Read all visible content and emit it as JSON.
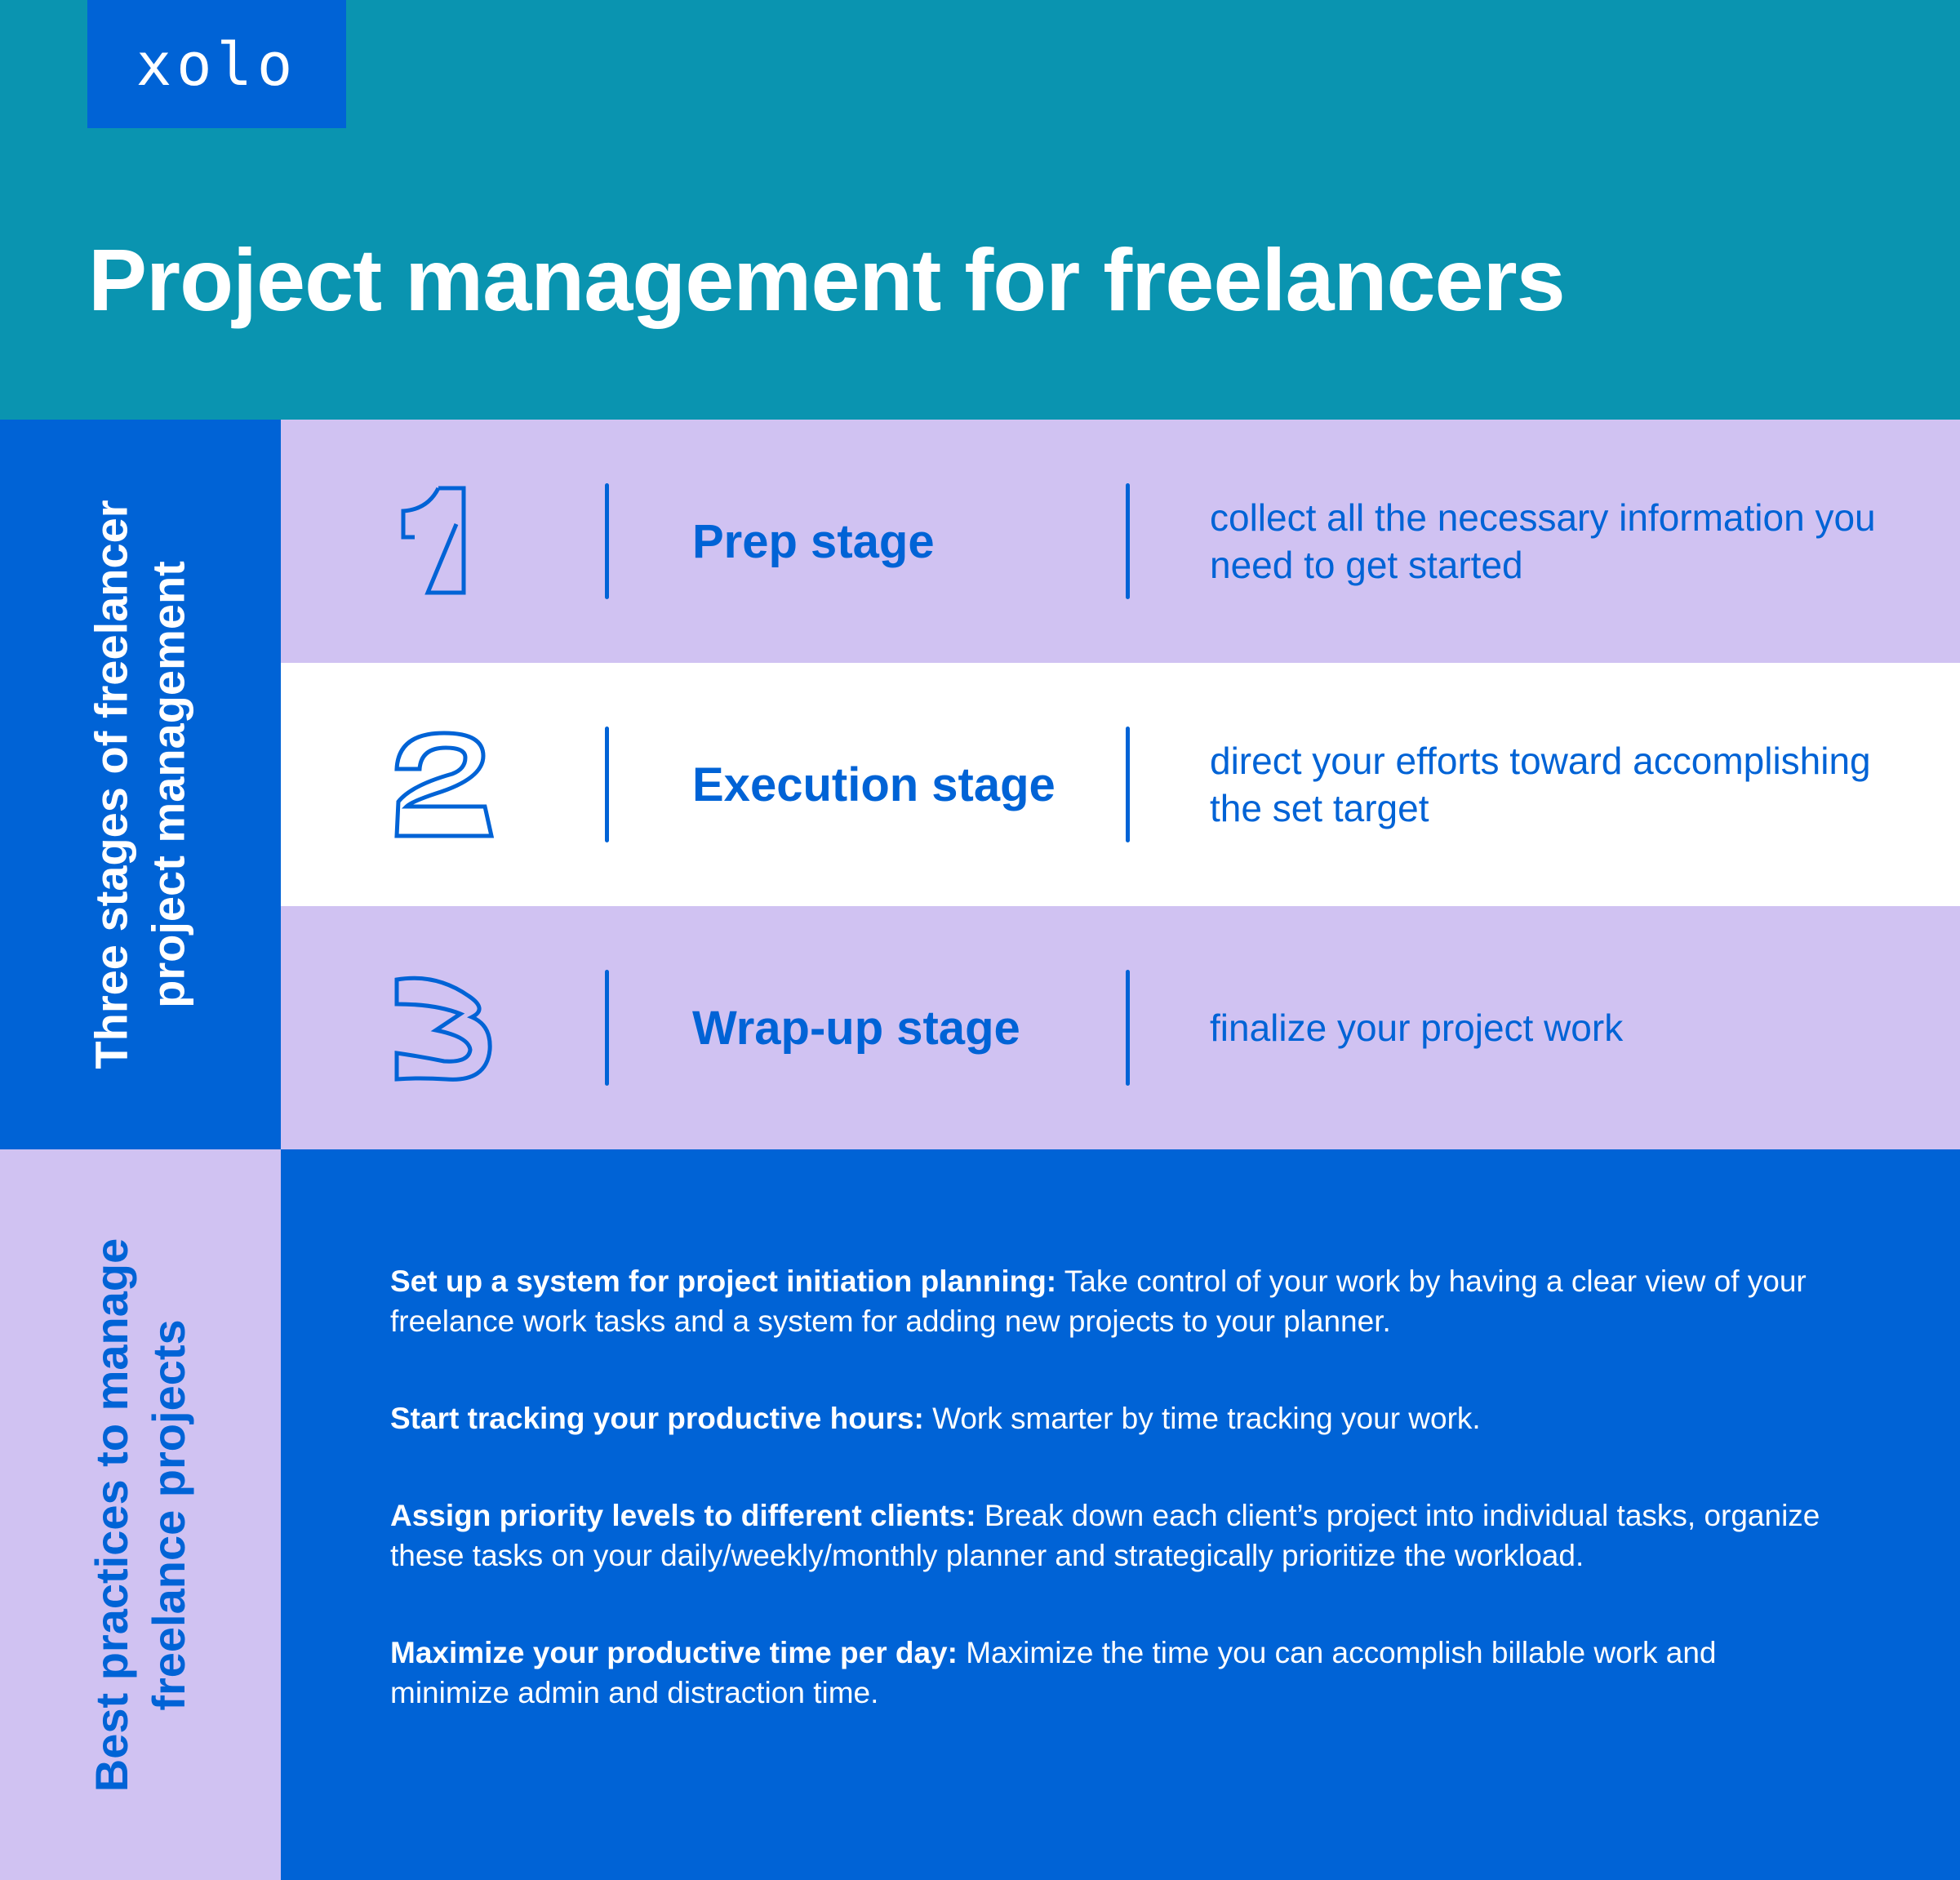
{
  "logo": "xolo",
  "title": "Project management for freelancers",
  "colors": {
    "header": "#0a94b0",
    "blue": "#0063d6",
    "lavender": "#d0c2f2",
    "white": "#ffffff"
  },
  "stages_section": {
    "label_line1": "Three stages of freelancer",
    "label_line2": "project management",
    "stages": [
      {
        "number": "1",
        "title": "Prep stage",
        "description": "collect all the necessary information you need to get started"
      },
      {
        "number": "2",
        "title": "Execution stage",
        "description": "direct your efforts toward accomplishing the set target"
      },
      {
        "number": "3",
        "title": "Wrap-up stage",
        "description": "finalize your project work"
      }
    ]
  },
  "practices_section": {
    "label_line1": "Best practices to manage",
    "label_line2": "freelance projects",
    "items": [
      {
        "heading": "Set up a system for project initiation planning:",
        "text": "Take control of your work by having a clear view of your freelance work tasks and a system for adding new projects to your planner."
      },
      {
        "heading": "Start tracking your productive hours:",
        "text": "Work smarter by time tracking your work."
      },
      {
        "heading": "Assign priority levels to different clients:",
        "text": "Break down each client’s project into individual tasks, organize these tasks on your daily/weekly/monthly planner and strategically prioritize the workload."
      },
      {
        "heading": "Maximize your productive time per day:",
        "text": "Maximize the time you can accomplish billable work and minimize admin and distraction time."
      }
    ]
  }
}
